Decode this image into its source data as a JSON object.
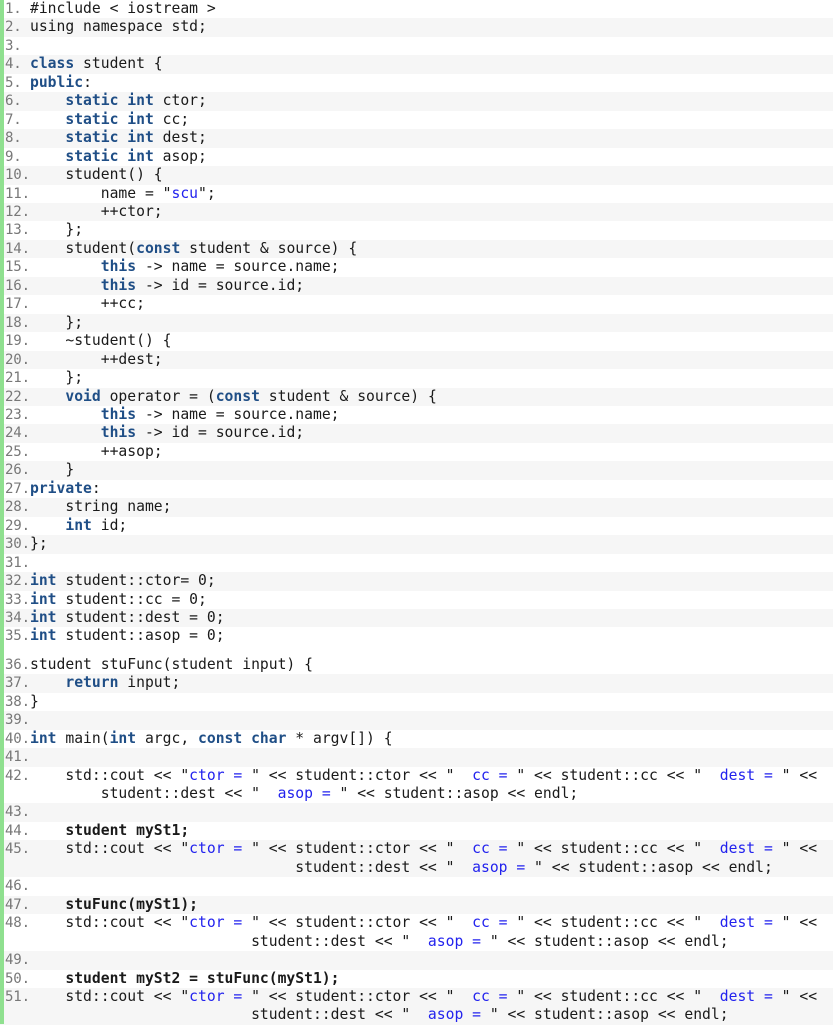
{
  "editor": {
    "language": "C++",
    "gutter_accent_color": "#8fe08f",
    "keyword_color": "#1f4e86",
    "string_color": "#2222ee",
    "text_color": "#1a1a1a",
    "line_number_color": "#787878",
    "stripe_color": "#f6f6f6",
    "background_color": "#ffffff",
    "first_line_number": 1,
    "last_line_number": 51,
    "total_lines": 51
  },
  "lines": [
    {
      "n": "1.",
      "text": "#include < iostream >"
    },
    {
      "n": "2.",
      "text": "using namespace std;"
    },
    {
      "n": "3.",
      "text": ""
    },
    {
      "n": "4.",
      "text": "class student {"
    },
    {
      "n": "5.",
      "text": "public:"
    },
    {
      "n": "6.",
      "text": "    static int ctor;"
    },
    {
      "n": "7.",
      "text": "    static int cc;"
    },
    {
      "n": "8.",
      "text": "    static int dest;"
    },
    {
      "n": "9.",
      "text": "    static int asop;"
    },
    {
      "n": "10.",
      "text": "    student() {"
    },
    {
      "n": "11.",
      "text": "        name = \"scu\";"
    },
    {
      "n": "12.",
      "text": "        ++ctor;"
    },
    {
      "n": "13.",
      "text": "    };"
    },
    {
      "n": "14.",
      "text": "    student(const student & source) {"
    },
    {
      "n": "15.",
      "text": "        this -> name = source.name;"
    },
    {
      "n": "16.",
      "text": "        this -> id = source.id;"
    },
    {
      "n": "17.",
      "text": "        ++cc;"
    },
    {
      "n": "18.",
      "text": "    };"
    },
    {
      "n": "19.",
      "text": "    ~student() {"
    },
    {
      "n": "20.",
      "text": "        ++dest;"
    },
    {
      "n": "21.",
      "text": "    };"
    },
    {
      "n": "22.",
      "text": "    void operator = (const student & source) {"
    },
    {
      "n": "23.",
      "text": "        this -> name = source.name;"
    },
    {
      "n": "24.",
      "text": "        this -> id = source.id;"
    },
    {
      "n": "25.",
      "text": "        ++asop;"
    },
    {
      "n": "26.",
      "text": "    }"
    },
    {
      "n": "27.",
      "text": "private:"
    },
    {
      "n": "28.",
      "text": "    string name;"
    },
    {
      "n": "29.",
      "text": "    int id;"
    },
    {
      "n": "30.",
      "text": "};"
    },
    {
      "n": "31.",
      "text": ""
    },
    {
      "n": "32.",
      "text": "int student::ctor= 0;"
    },
    {
      "n": "33.",
      "text": "int student::cc = 0;"
    },
    {
      "n": "34.",
      "text": "int student::dest = 0;"
    },
    {
      "n": "35.",
      "text": "int student::asop = 0;"
    },
    {
      "n": "36.",
      "text": "student stuFunc(student input) {"
    },
    {
      "n": "37.",
      "text": "    return input;"
    },
    {
      "n": "38.",
      "text": "}"
    },
    {
      "n": "39.",
      "text": ""
    },
    {
      "n": "40.",
      "text": "int main(int argc, const char * argv[]) {"
    },
    {
      "n": "41.",
      "text": ""
    },
    {
      "n": "42.",
      "text": "    std::cout << \"ctor = \" << student::ctor << \"  cc = \" << student::cc << \"  dest = \" <<",
      "cont": "        student::dest << \"  asop = \" << student::asop << endl;"
    },
    {
      "n": "43.",
      "text": ""
    },
    {
      "n": "44.",
      "text": "    student mySt1;"
    },
    {
      "n": "45.",
      "text": "    std::cout << \"ctor = \" << student::ctor << \"  cc = \" << student::cc << \"  dest = \" <<",
      "cont": "                              student::dest << \"  asop = \" << student::asop << endl;"
    },
    {
      "n": "46.",
      "text": ""
    },
    {
      "n": "47.",
      "text": "    stuFunc(mySt1);"
    },
    {
      "n": "48.",
      "text": "    std::cout << \"ctor = \" << student::ctor << \"  cc = \" << student::cc << \"  dest = \" <<",
      "cont": "                         student::dest << \"  asop = \" << student::asop << endl;"
    },
    {
      "n": "49.",
      "text": ""
    },
    {
      "n": "50.",
      "text": "    student mySt2 = stuFunc(mySt1);"
    },
    {
      "n": "51.",
      "text": "    std::cout << \"ctor = \" << student::ctor << \"  cc = \" << student::cc << \"  dest = \" <<",
      "cont": "                         student::dest << \"  asop = \" << student::asop << endl;"
    }
  ],
  "bold_lines": [
    "44.",
    "47.",
    "50."
  ],
  "gap_after_lines": [
    "35."
  ],
  "keywords": [
    "class",
    "public",
    "private",
    "static",
    "int",
    "const",
    "this",
    "void",
    "return",
    "char"
  ]
}
